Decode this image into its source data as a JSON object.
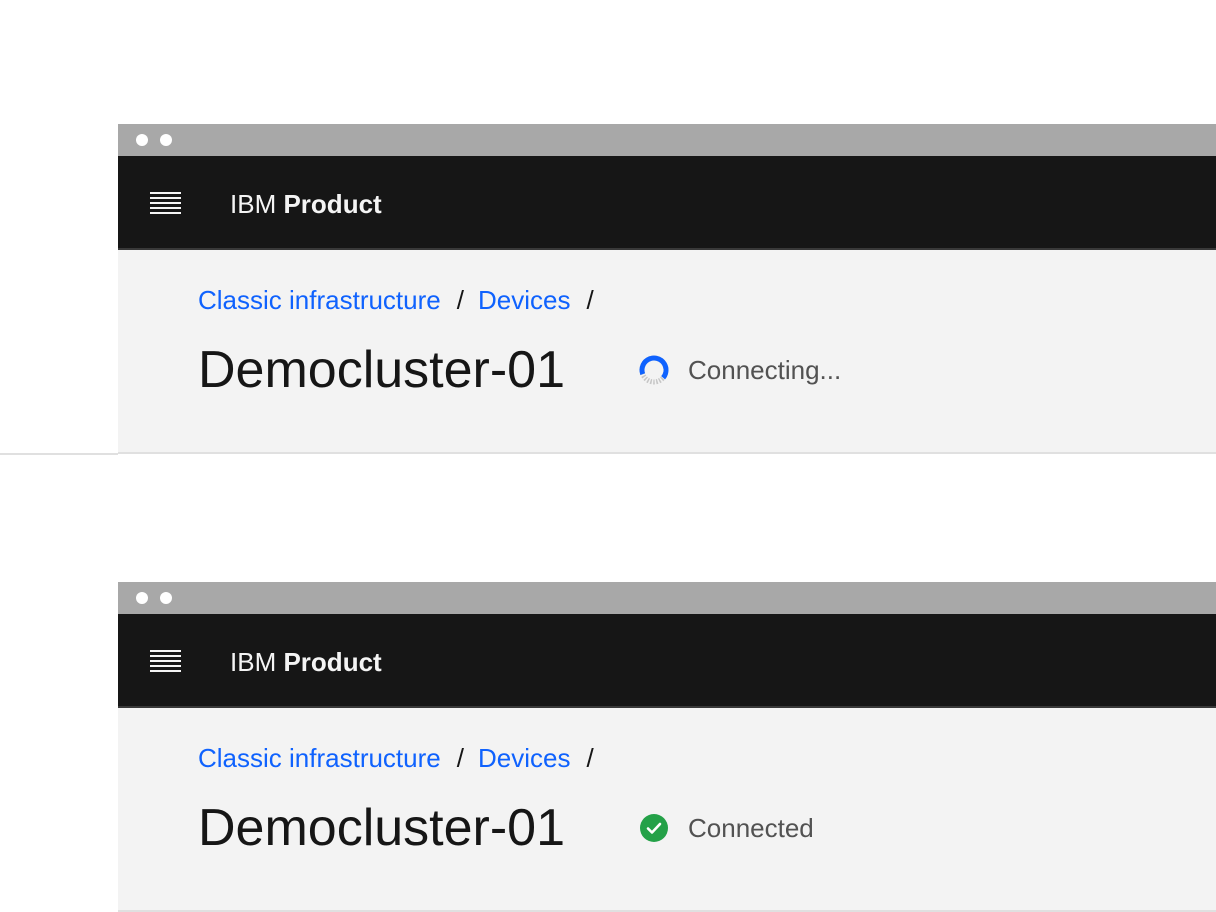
{
  "windows": [
    {
      "header": {
        "brand": "IBM",
        "product": "Product"
      },
      "breadcrumb": {
        "items": [
          "Classic infrastructure",
          "Devices"
        ],
        "separator": "/"
      },
      "page_title": "Democluster-01",
      "status": {
        "icon": "loading-spinner-icon",
        "text": "Connecting...",
        "color": "#0f62fe"
      }
    },
    {
      "header": {
        "brand": "IBM",
        "product": "Product"
      },
      "breadcrumb": {
        "items": [
          "Classic infrastructure",
          "Devices"
        ],
        "separator": "/"
      },
      "page_title": "Democluster-01",
      "status": {
        "icon": "checkmark-filled-icon",
        "text": "Connected",
        "color": "#24a148"
      }
    }
  ]
}
